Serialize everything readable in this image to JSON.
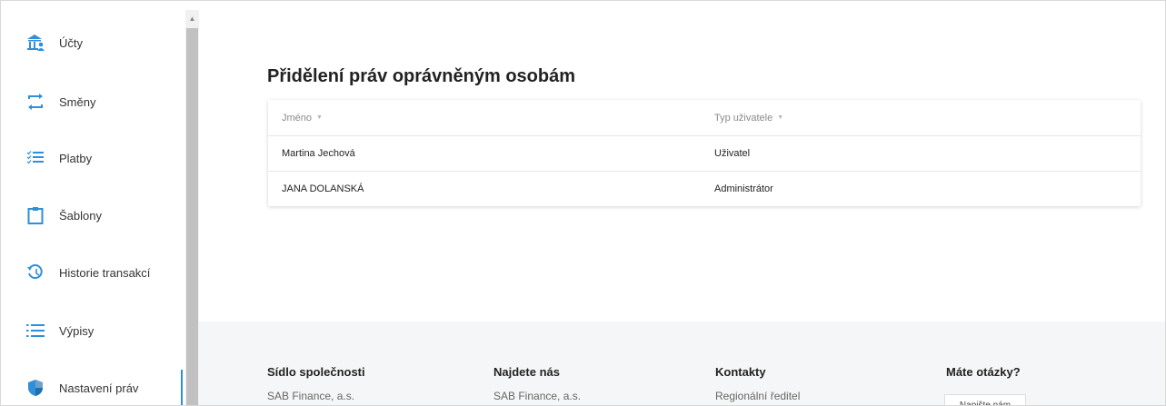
{
  "sidebar": {
    "items": [
      {
        "label": "Účty",
        "icon": "bank-account-icon"
      },
      {
        "label": "Směny",
        "icon": "exchange-arrows-icon"
      },
      {
        "label": "Platby",
        "icon": "checklist-icon"
      },
      {
        "label": "Šablony",
        "icon": "clipboard-icon"
      },
      {
        "label": "Historie transakcí",
        "icon": "history-icon"
      },
      {
        "label": "Výpisy",
        "icon": "list-icon"
      },
      {
        "label": "Nastavení práv",
        "icon": "shield-icon",
        "active": true
      }
    ]
  },
  "main": {
    "title": "Přidělení práv oprávněným osobám",
    "table": {
      "columns": [
        "Jméno",
        "Typ uživatele"
      ],
      "rows": [
        [
          "Martina Jechová",
          "Uživatel"
        ],
        [
          "JANA DOLANSKÁ",
          "Administrátor"
        ]
      ]
    }
  },
  "footer": {
    "columns": [
      {
        "heading": "Sídlo společnosti",
        "text": "SAB Finance, a.s."
      },
      {
        "heading": "Najdete nás",
        "text": "SAB Finance, a.s."
      },
      {
        "heading": "Kontakty",
        "text": "Regionální ředitel"
      },
      {
        "heading": "Máte otázky?",
        "text": ""
      }
    ],
    "button_label": "Napište nám"
  },
  "colors": {
    "accent": "#2f8fd8",
    "footer_bg": "#f5f6f7"
  }
}
